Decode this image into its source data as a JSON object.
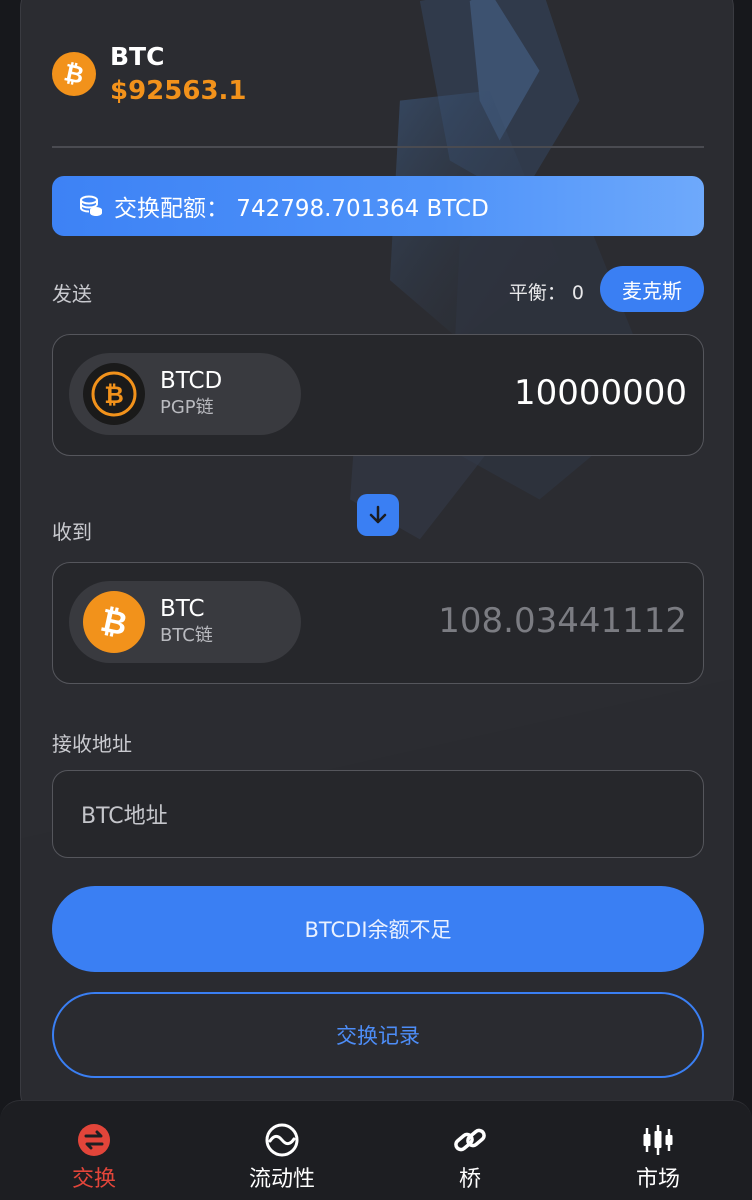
{
  "header": {
    "symbol": "BTC",
    "price": "$92563.1"
  },
  "quota": {
    "text": "交换配额：  742798.701364 BTCD",
    "icon": "coins-stack-icon"
  },
  "send": {
    "label": "发送",
    "balance_text": "平衡：  0",
    "max_label": "麦克斯",
    "token_symbol": "BTCD",
    "token_chain": "PGP链",
    "amount": "10000000"
  },
  "receive": {
    "label": "收到",
    "token_symbol": "BTC",
    "token_chain": "BTC链",
    "amount": "108.03441112"
  },
  "address": {
    "label": "接收地址",
    "placeholder": "BTC地址"
  },
  "actions": {
    "primary": "BTCDI余额不足",
    "secondary": "交换记录"
  },
  "tabs": [
    {
      "label": "交换",
      "icon": "swap-icon",
      "active": true
    },
    {
      "label": "流动性",
      "icon": "liquidity-icon",
      "active": false
    },
    {
      "label": "桥",
      "icon": "link-icon",
      "active": false
    },
    {
      "label": "市场",
      "icon": "candlestick-icon",
      "active": false
    }
  ],
  "colors": {
    "accent": "#3a7ff3",
    "btc_orange": "#f2921b",
    "active_tab": "#e2453a",
    "card_bg": "#2b2c31"
  }
}
